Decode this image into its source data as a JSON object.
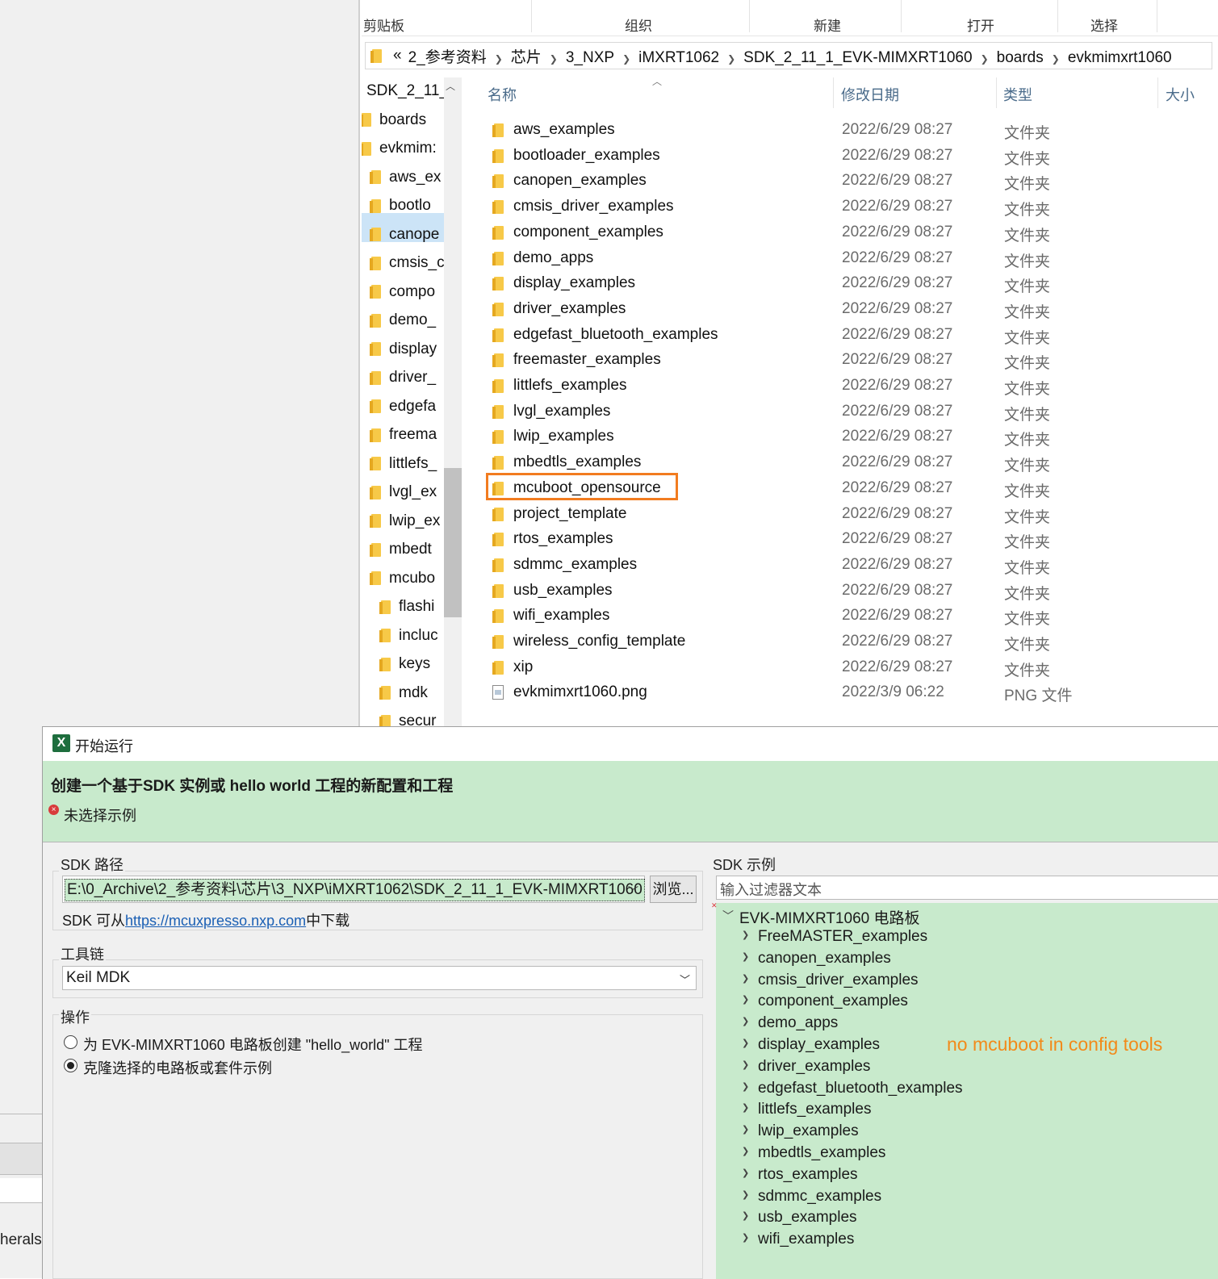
{
  "left_bg": {
    "partial_text": "herals"
  },
  "explorer": {
    "ribbon": {
      "groups": [
        "剪贴板",
        "组织",
        "新建",
        "打开",
        "选择"
      ]
    },
    "address": {
      "overflow": "«",
      "segments": [
        "2_参考资料",
        "芯片",
        "3_NXP",
        "iMXRT1062",
        "SDK_2_11_1_EVK-MIMXRT1060",
        "boards",
        "evkmimxrt1060"
      ]
    },
    "nav": {
      "items": [
        {
          "label": "SDK_2_11_",
          "level": 0,
          "folder": false
        },
        {
          "label": "boards",
          "level": 0,
          "folder": true
        },
        {
          "label": "evkmim:",
          "level": 1,
          "folder": true,
          "selected": true
        },
        {
          "label": "aws_ex",
          "level": 2,
          "folder": true
        },
        {
          "label": "bootlo",
          "level": 2,
          "folder": true
        },
        {
          "label": "canope",
          "level": 2,
          "folder": true
        },
        {
          "label": "cmsis_c",
          "level": 2,
          "folder": true
        },
        {
          "label": "compo",
          "level": 2,
          "folder": true
        },
        {
          "label": "demo_",
          "level": 2,
          "folder": true
        },
        {
          "label": "display",
          "level": 2,
          "folder": true
        },
        {
          "label": "driver_",
          "level": 2,
          "folder": true
        },
        {
          "label": "edgefa",
          "level": 2,
          "folder": true
        },
        {
          "label": "freema",
          "level": 2,
          "folder": true
        },
        {
          "label": "littlefs_",
          "level": 2,
          "folder": true
        },
        {
          "label": "lvgl_ex",
          "level": 2,
          "folder": true
        },
        {
          "label": "lwip_ex",
          "level": 2,
          "folder": true
        },
        {
          "label": "mbedt",
          "level": 2,
          "folder": true
        },
        {
          "label": "mcubo",
          "level": 2,
          "folder": true
        },
        {
          "label": "flashi",
          "level": 3,
          "folder": true
        },
        {
          "label": "incluc",
          "level": 3,
          "folder": true
        },
        {
          "label": "keys",
          "level": 3,
          "folder": true
        },
        {
          "label": "mdk",
          "level": 3,
          "folder": true
        },
        {
          "label": "secur",
          "level": 3,
          "folder": true
        }
      ]
    },
    "columns": {
      "name": "名称",
      "date": "修改日期",
      "type": "类型",
      "size": "大小"
    },
    "files": [
      {
        "name": "aws_examples",
        "date": "2022/6/29 08:27",
        "type": "文件夹",
        "icon": "folder"
      },
      {
        "name": "bootloader_examples",
        "date": "2022/6/29 08:27",
        "type": "文件夹",
        "icon": "folder"
      },
      {
        "name": "canopen_examples",
        "date": "2022/6/29 08:27",
        "type": "文件夹",
        "icon": "folder"
      },
      {
        "name": "cmsis_driver_examples",
        "date": "2022/6/29 08:27",
        "type": "文件夹",
        "icon": "folder"
      },
      {
        "name": "component_examples",
        "date": "2022/6/29 08:27",
        "type": "文件夹",
        "icon": "folder"
      },
      {
        "name": "demo_apps",
        "date": "2022/6/29 08:27",
        "type": "文件夹",
        "icon": "folder"
      },
      {
        "name": "display_examples",
        "date": "2022/6/29 08:27",
        "type": "文件夹",
        "icon": "folder"
      },
      {
        "name": "driver_examples",
        "date": "2022/6/29 08:27",
        "type": "文件夹",
        "icon": "folder"
      },
      {
        "name": "edgefast_bluetooth_examples",
        "date": "2022/6/29 08:27",
        "type": "文件夹",
        "icon": "folder"
      },
      {
        "name": "freemaster_examples",
        "date": "2022/6/29 08:27",
        "type": "文件夹",
        "icon": "folder"
      },
      {
        "name": "littlefs_examples",
        "date": "2022/6/29 08:27",
        "type": "文件夹",
        "icon": "folder"
      },
      {
        "name": "lvgl_examples",
        "date": "2022/6/29 08:27",
        "type": "文件夹",
        "icon": "folder"
      },
      {
        "name": "lwip_examples",
        "date": "2022/6/29 08:27",
        "type": "文件夹",
        "icon": "folder"
      },
      {
        "name": "mbedtls_examples",
        "date": "2022/6/29 08:27",
        "type": "文件夹",
        "icon": "folder"
      },
      {
        "name": "mcuboot_opensource",
        "date": "2022/6/29 08:27",
        "type": "文件夹",
        "icon": "folder",
        "highlighted": true
      },
      {
        "name": "project_template",
        "date": "2022/6/29 08:27",
        "type": "文件夹",
        "icon": "folder"
      },
      {
        "name": "rtos_examples",
        "date": "2022/6/29 08:27",
        "type": "文件夹",
        "icon": "folder"
      },
      {
        "name": "sdmmc_examples",
        "date": "2022/6/29 08:27",
        "type": "文件夹",
        "icon": "folder"
      },
      {
        "name": "usb_examples",
        "date": "2022/6/29 08:27",
        "type": "文件夹",
        "icon": "folder"
      },
      {
        "name": "wifi_examples",
        "date": "2022/6/29 08:27",
        "type": "文件夹",
        "icon": "folder"
      },
      {
        "name": "wireless_config_template",
        "date": "2022/6/29 08:27",
        "type": "文件夹",
        "icon": "folder"
      },
      {
        "name": "xip",
        "date": "2022/6/29 08:27",
        "type": "文件夹",
        "icon": "folder"
      },
      {
        "name": "evkmimxrt1060.png",
        "date": "2022/3/9 06:22",
        "type": "PNG 文件",
        "icon": "png-file"
      }
    ],
    "highlight_color": "#f27c20"
  },
  "dialog": {
    "title": "开始运行",
    "logo_letter": "X",
    "heading": "创建一个基于SDK 实例或 hello world 工程的新配置和工程",
    "error": "未选择示例",
    "sdk_path_group": "SDK 路径",
    "sdk_path_value": "E:\\0_Archive\\2_参考资料\\芯片\\3_NXP\\iMXRT1062\\SDK_2_11_1_EVK-MIMXRT1060",
    "browse_label": "浏览...",
    "download_prefix": "SDK 可从",
    "download_link": "https://mcuxpresso.nxp.com",
    "download_suffix": "中下载",
    "toolchain_group": "工具链",
    "toolchain_value": "Keil MDK",
    "action_group": "操作",
    "radio_create": "为 EVK-MIMXRT1060 电路板创建 \"hello_world\" 工程",
    "radio_clone": "克隆选择的电路板或套件示例",
    "examples_group": "SDK 示例",
    "filter_placeholder": "输入过滤器文本",
    "tree_root": "EVK-MIMXRT1060 电路板",
    "tree_items": [
      "FreeMASTER_examples",
      "canopen_examples",
      "cmsis_driver_examples",
      "component_examples",
      "demo_apps",
      "display_examples",
      "driver_examples",
      "edgefast_bluetooth_examples",
      "littlefs_examples",
      "lwip_examples",
      "mbedtls_examples",
      "rtos_examples",
      "sdmmc_examples",
      "usb_examples",
      "wifi_examples"
    ],
    "annotation": "no mcuboot in config tools",
    "banner_color": "#c8eacc",
    "annotation_color": "#f28a1a"
  }
}
